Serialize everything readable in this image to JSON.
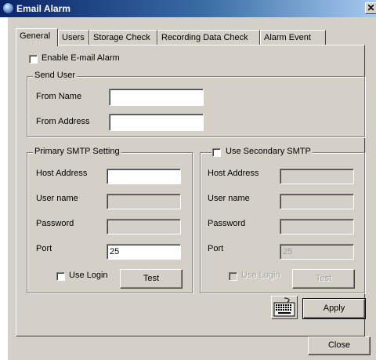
{
  "window": {
    "title": "Email Alarm",
    "close_glyph": "✕"
  },
  "tabs": [
    {
      "label": "General",
      "active": true
    },
    {
      "label": "Users",
      "active": false
    },
    {
      "label": "Storage Check",
      "active": false
    },
    {
      "label": "Recording Data Check",
      "active": false
    },
    {
      "label": "Alarm Event",
      "active": false
    }
  ],
  "enable_alarm": {
    "label": "Enable E-mail Alarm",
    "checked": false
  },
  "send_user": {
    "title": "Send User",
    "from_name_label": "From Name",
    "from_name_value": "",
    "from_address_label": "From Address",
    "from_address_value": ""
  },
  "primary_smtp": {
    "title": "Primary SMTP Setting",
    "host_label": "Host Address",
    "host_value": "",
    "user_label": "User name",
    "user_value": "",
    "password_label": "Password",
    "password_value": "",
    "port_label": "Port",
    "port_value": "25",
    "use_login_label": "Use Login",
    "use_login_checked": false,
    "test_label": "Test"
  },
  "secondary_smtp": {
    "title": "Use Secondary SMTP",
    "enabled": false,
    "host_label": "Host Address",
    "user_label": "User name",
    "password_label": "Password",
    "port_label": "Port",
    "port_value": "25",
    "use_login_label": "Use Login",
    "test_label": "Test"
  },
  "buttons": {
    "apply": "Apply",
    "close": "Close"
  },
  "icons": {
    "app": "globe-icon",
    "keyboard": "keyboard-icon"
  }
}
